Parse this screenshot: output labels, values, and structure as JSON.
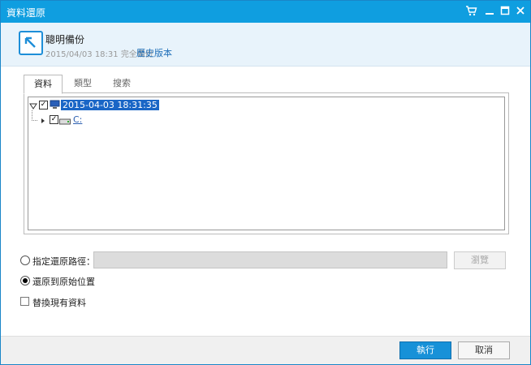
{
  "window": {
    "title": "資料還原"
  },
  "header": {
    "name": "聰明備份",
    "subtitle": "2015/04/03 18:31 完全備份",
    "history_link": "歷史版本"
  },
  "tabs": [
    {
      "label": "資料",
      "active": true
    },
    {
      "label": "類型",
      "active": false
    },
    {
      "label": "搜索",
      "active": false
    }
  ],
  "tree": {
    "root": {
      "label": "2015-04-03 18:31:35",
      "checked": true,
      "expanded": true
    },
    "child": {
      "label": "C:",
      "checked": true,
      "expanded": false
    }
  },
  "options": {
    "specify_path": {
      "label": "指定還原路徑：",
      "selected": false,
      "browse_label": "瀏覽"
    },
    "original_location": {
      "label": "還原到原始位置",
      "selected": true
    },
    "replace_existing": {
      "label": "替換現有資料",
      "checked": false
    }
  },
  "footer": {
    "run_label": "執行",
    "cancel_label": "取消"
  },
  "colors": {
    "titlebar": "#0f9ee0",
    "accent": "#1791d8",
    "selection": "#1a66c6"
  }
}
